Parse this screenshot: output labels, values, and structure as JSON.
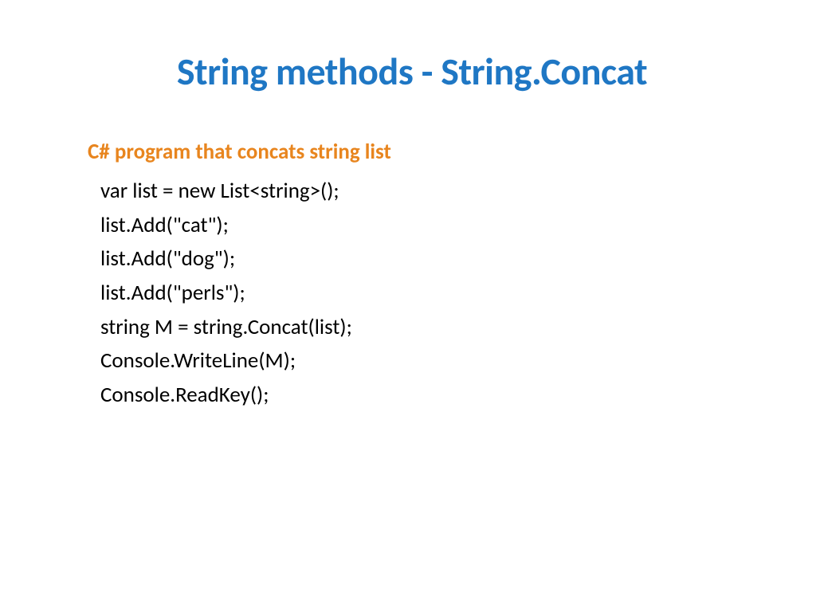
{
  "slide": {
    "title": "String methods - String.Concat",
    "subtitle": "C# program that concats string list",
    "code_lines": [
      "var list = new List<string>();",
      "list.Add(\"cat\");",
      "list.Add(\"dog\");",
      "list.Add(\"perls\");",
      "string M = string.Concat(list);",
      "Console.WriteLine(M);",
      "Console.ReadKey();"
    ]
  }
}
